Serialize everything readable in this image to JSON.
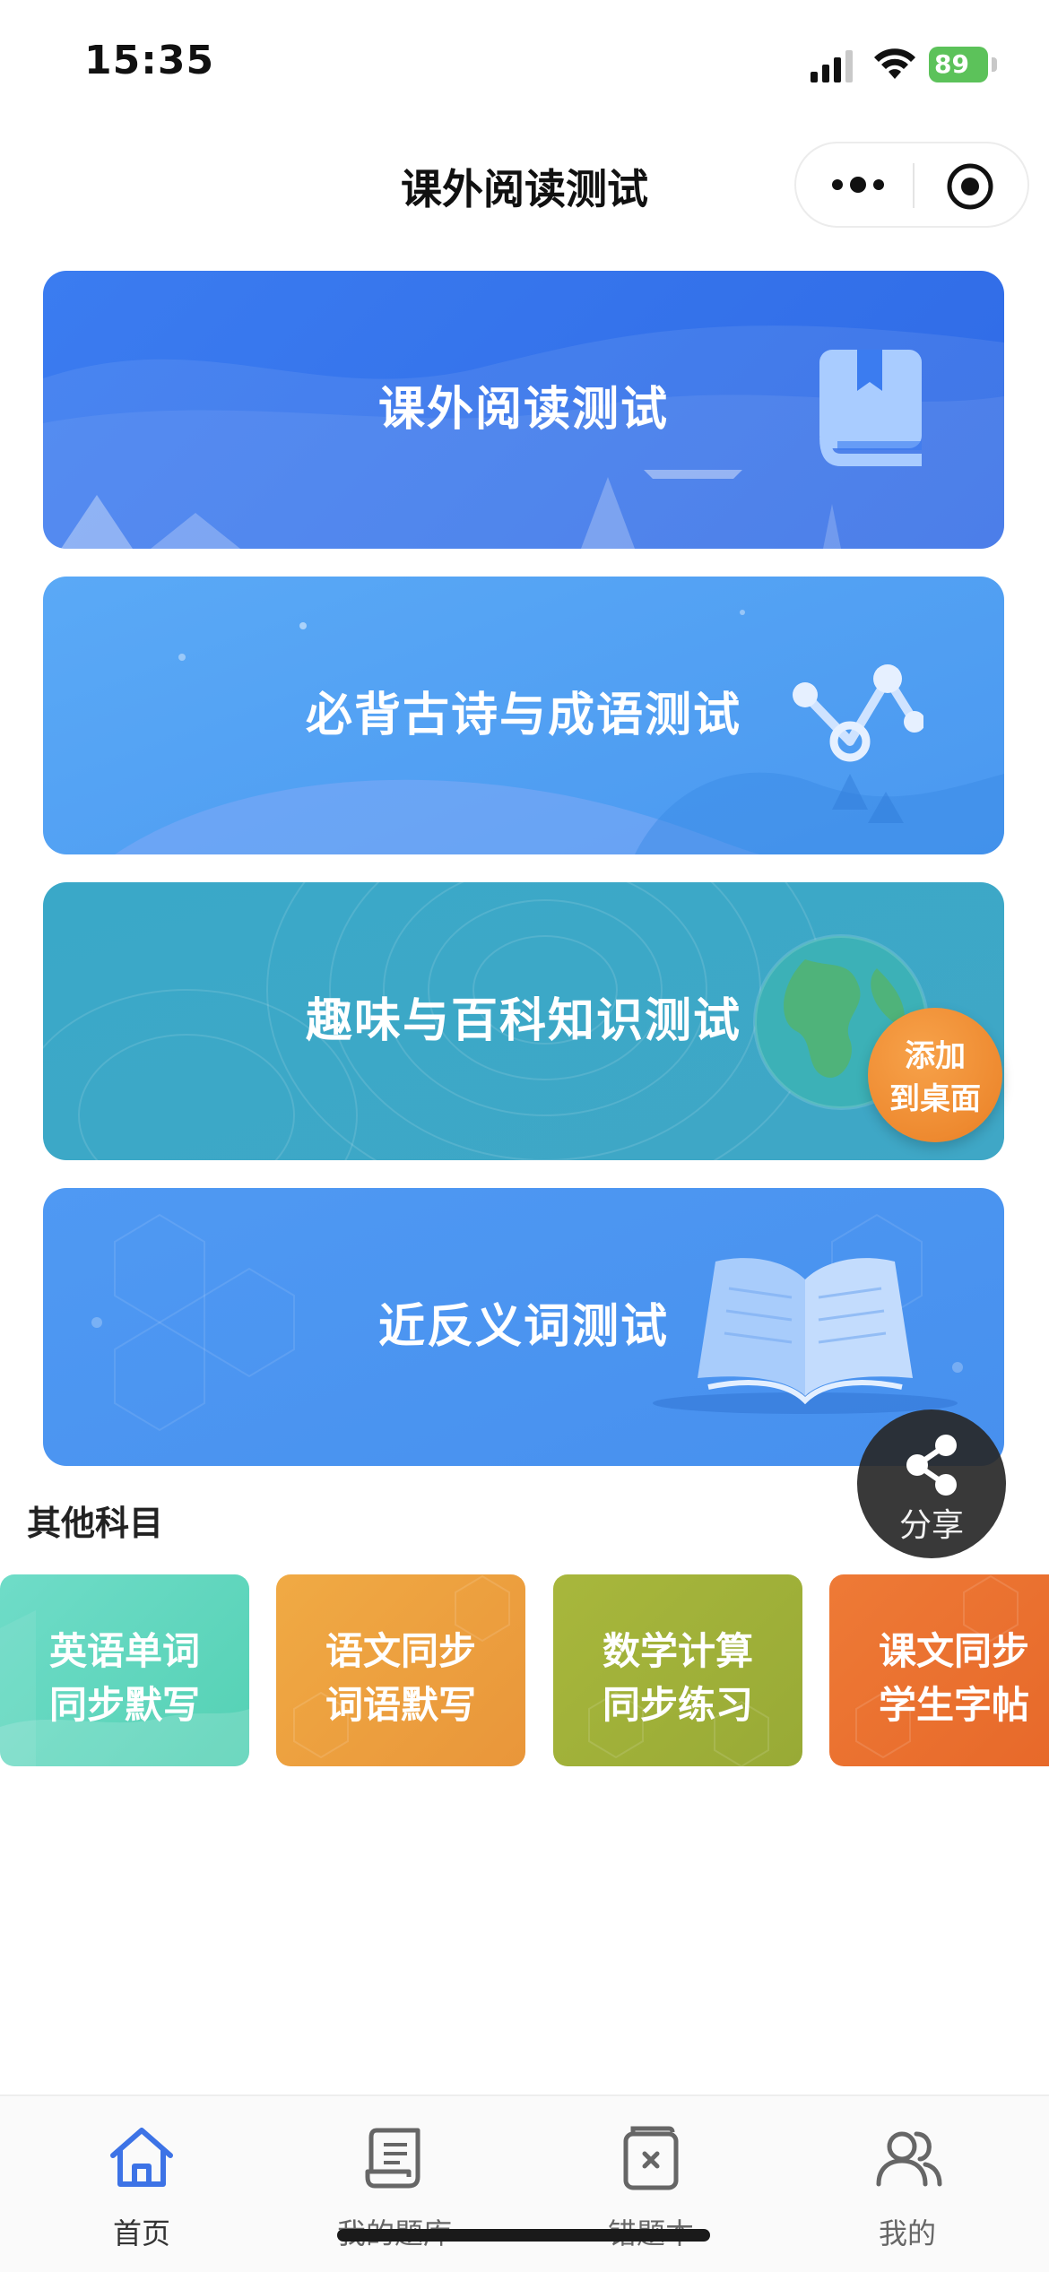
{
  "status_bar": {
    "time": "15:35",
    "battery": "89"
  },
  "nav": {
    "title": "课外阅读测试",
    "more_icon": "more-dots-icon",
    "close_icon": "target-close-icon"
  },
  "test_cards": [
    {
      "label": "课外阅读测试",
      "icon": "bookmark-book-icon",
      "color": "#3b7cf0"
    },
    {
      "label": "必背古诗与成语测试",
      "icon": "line-chart-nodes-icon",
      "color": "#5aa9f6"
    },
    {
      "label": "趣味与百科知识测试",
      "icon": "globe-icon",
      "color": "#3aa8c8"
    },
    {
      "label": "近反义词测试",
      "icon": "open-book-icon",
      "color": "#4f99f3"
    }
  ],
  "floating": {
    "add_desktop_line1": "添加",
    "add_desktop_line2": "到桌面",
    "share_label": "分享"
  },
  "other_subjects": {
    "title": "其他科目",
    "items": [
      {
        "line1": "英语单词",
        "line2": "同步默写",
        "color": "#6fdcc8"
      },
      {
        "line1": "语文同步",
        "line2": "词语默写",
        "color": "#f0aa44"
      },
      {
        "line1": "数学计算",
        "line2": "同步练习",
        "color": "#a8b73c"
      },
      {
        "line1": "课文同步",
        "line2": "学生字帖",
        "color": "#ee7a36"
      }
    ]
  },
  "tab_bar": {
    "items": [
      {
        "label": "首页",
        "icon": "home-icon",
        "active": true
      },
      {
        "label": "我的题库",
        "icon": "scroll-document-icon",
        "active": false
      },
      {
        "label": "错题本",
        "icon": "wrong-notebook-icon",
        "active": false
      },
      {
        "label": "我的",
        "icon": "users-icon",
        "active": false
      }
    ]
  }
}
